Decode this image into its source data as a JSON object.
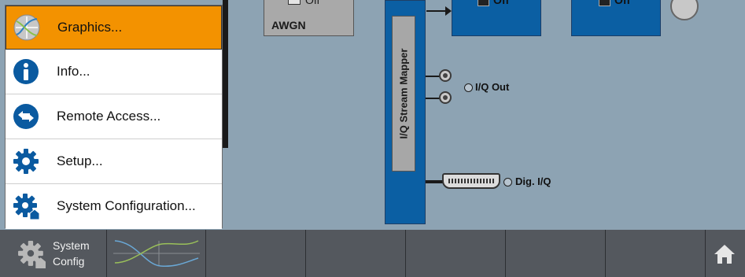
{
  "menu": {
    "items": [
      {
        "label": "Graphics...",
        "icon": "graphics-icon",
        "active": true
      },
      {
        "label": "Info...",
        "icon": "info-icon",
        "active": false
      },
      {
        "label": "Remote Access...",
        "icon": "remote-access-icon",
        "active": false
      },
      {
        "label": "Setup...",
        "icon": "gear-icon",
        "active": false
      },
      {
        "label": "System Configuration...",
        "icon": "system-config-icon",
        "active": false
      }
    ]
  },
  "diagram": {
    "awgn_label": "AWGN",
    "awgn_state": "Off",
    "block2_state": "Off",
    "block3_state": "Off",
    "mapper_label": "I/Q Stream Mapper",
    "iq_out_label": "I/Q Out",
    "dig_iq_label": "Dig. I/Q"
  },
  "taskbar": {
    "system_config_line1": "System",
    "system_config_line2": "Config"
  },
  "colors": {
    "accent": "#f39200",
    "block_blue": "#0b5fa3",
    "background": "#8da3b3",
    "taskbar": "#54585e",
    "icon_blue": "#0a5aa0"
  }
}
